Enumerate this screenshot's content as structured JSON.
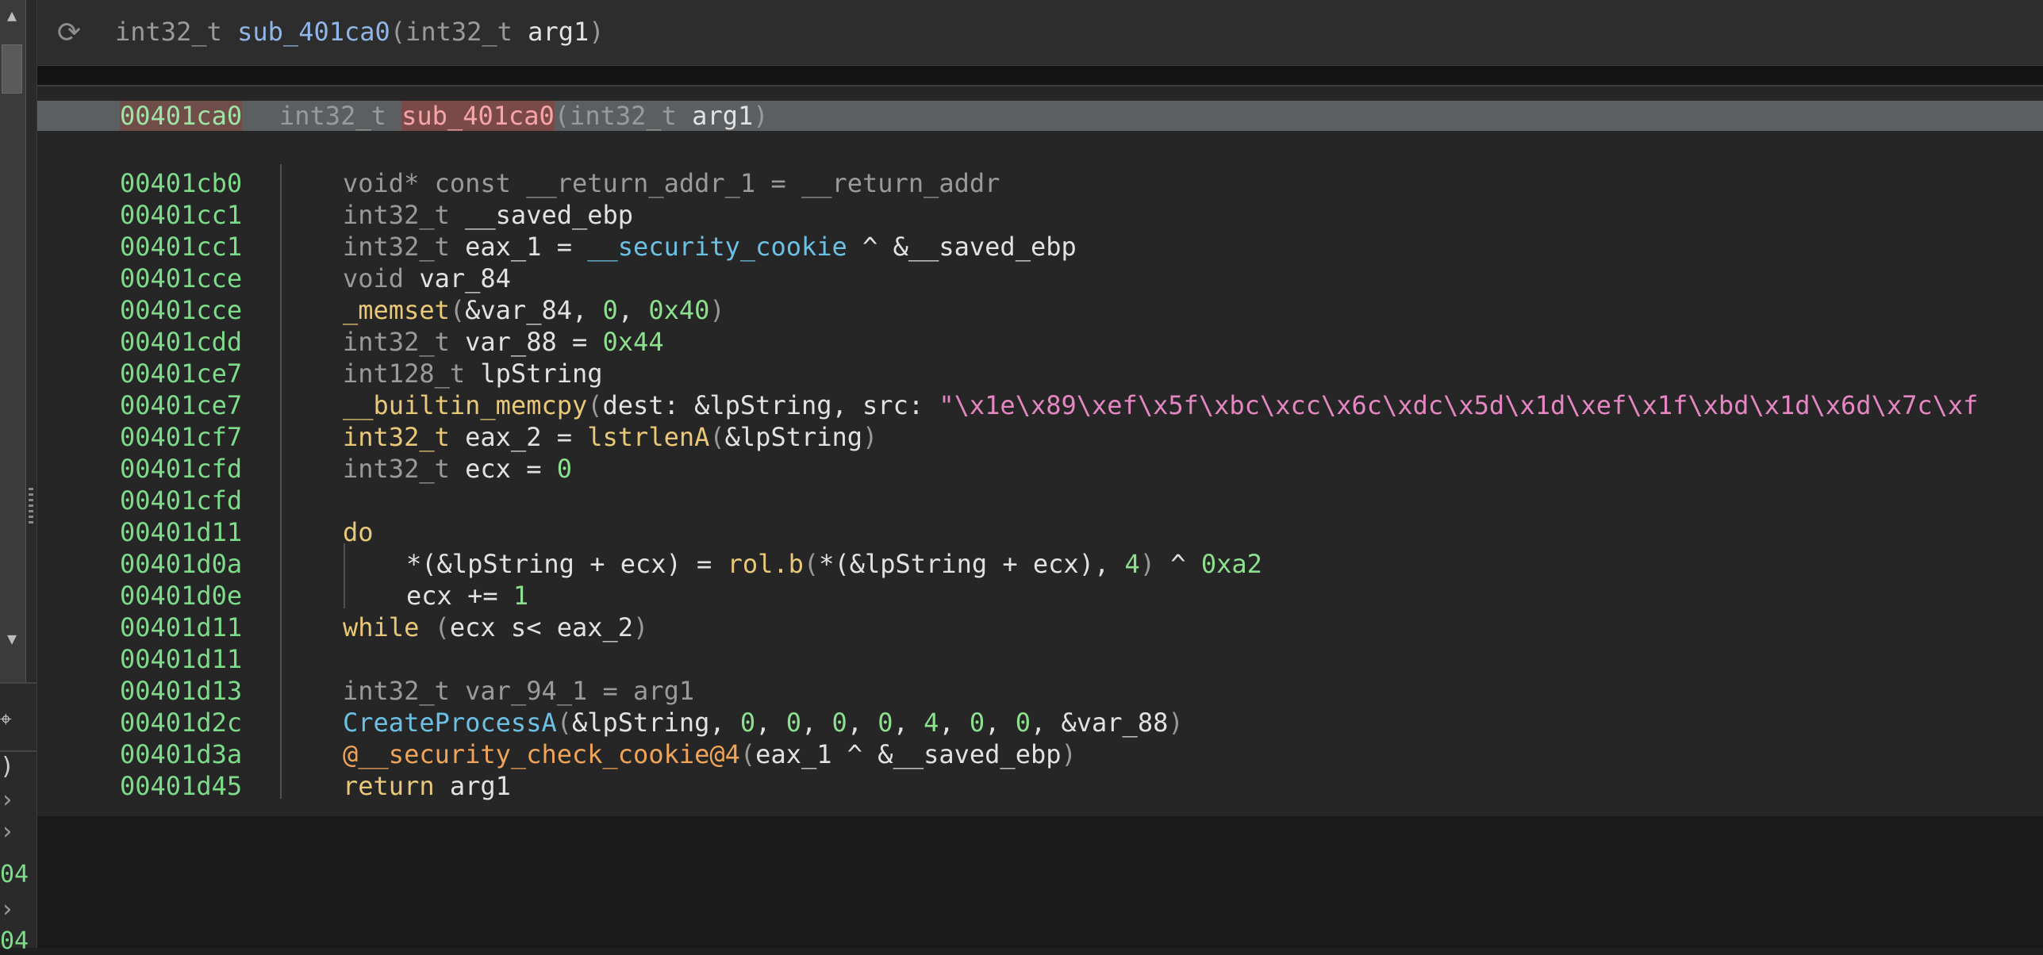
{
  "header": {
    "signature": {
      "ret": "int32_t ",
      "name": "sub_401ca0",
      "open": "(",
      "ptype": "int32_t ",
      "param": "arg1",
      "close": ")"
    }
  },
  "func_row": {
    "address": "00401ca0",
    "signature": {
      "ret": "int32_t ",
      "name": "sub_401ca0",
      "open": "(",
      "ptype": "int32_t ",
      "param": "arg1",
      "close": ")"
    }
  },
  "lines": [
    {
      "addr": "00401cb0",
      "indent": 0,
      "tokens": [
        [
          "void* const __return_addr_1 = __return_addr",
          "type"
        ]
      ]
    },
    {
      "addr": "00401cc1",
      "indent": 0,
      "tokens": [
        [
          "int32_t ",
          "type"
        ],
        [
          "__saved_ebp",
          "var"
        ]
      ]
    },
    {
      "addr": "00401cc1",
      "indent": 0,
      "tokens": [
        [
          "int32_t ",
          "type"
        ],
        [
          "eax_1 = ",
          "var"
        ],
        [
          "__security_cookie",
          "data"
        ],
        [
          " ^ &__saved_ebp",
          "var"
        ]
      ]
    },
    {
      "addr": "00401cce",
      "indent": 0,
      "tokens": [
        [
          "void ",
          "type"
        ],
        [
          "var_84",
          "var"
        ]
      ]
    },
    {
      "addr": "00401cce",
      "indent": 0,
      "tokens": [
        [
          "_memset",
          "fn"
        ],
        [
          "(",
          "p"
        ],
        [
          "&var_84, ",
          "var"
        ],
        [
          "0",
          "num"
        ],
        [
          ", ",
          "var"
        ],
        [
          "0x40",
          "num"
        ],
        [
          ")",
          "p"
        ]
      ]
    },
    {
      "addr": "00401cdd",
      "indent": 0,
      "tokens": [
        [
          "int32_t ",
          "type"
        ],
        [
          "var_88 = ",
          "var"
        ],
        [
          "0x44",
          "num"
        ]
      ]
    },
    {
      "addr": "00401ce7",
      "indent": 0,
      "tokens": [
        [
          "int128_t ",
          "type"
        ],
        [
          "lpString",
          "var"
        ]
      ]
    },
    {
      "addr": "00401ce7",
      "indent": 0,
      "tokens": [
        [
          "__builtin_memcpy",
          "fn"
        ],
        [
          "(",
          "p"
        ],
        [
          "dest: &lpString, src: ",
          "var"
        ],
        [
          "\"\\x1e\\x89\\xef\\x5f\\xbc\\xcc\\x6c\\xdc\\x5d\\x1d\\xef\\x1f\\xbd\\x1d\\x6d\\x7c\\xf",
          "str"
        ]
      ]
    },
    {
      "addr": "00401cf7",
      "indent": 0,
      "tokens": [
        [
          "int32_t ",
          "kw"
        ],
        [
          "eax_2 = ",
          "var"
        ],
        [
          "lstrlenA",
          "fn"
        ],
        [
          "(",
          "p"
        ],
        [
          "&lpString",
          "var"
        ],
        [
          ")",
          "p"
        ]
      ]
    },
    {
      "addr": "00401cfd",
      "indent": 0,
      "tokens": [
        [
          "int32_t ",
          "type"
        ],
        [
          "ecx = ",
          "var"
        ],
        [
          "0",
          "num"
        ]
      ]
    },
    {
      "addr": "00401cfd",
      "indent": 0,
      "tokens": []
    },
    {
      "addr": "00401d11",
      "indent": 0,
      "tokens": [
        [
          "do",
          "kw"
        ]
      ]
    },
    {
      "addr": "00401d0a",
      "indent": 1,
      "tokens": [
        [
          "*(&lpString + ecx) = ",
          "var"
        ],
        [
          "rol.b",
          "fn"
        ],
        [
          "(",
          "p"
        ],
        [
          "*(&lpString + ecx)",
          "var"
        ],
        [
          ", ",
          "var"
        ],
        [
          "4",
          "num"
        ],
        [
          ")",
          "p"
        ],
        [
          " ^ ",
          "var"
        ],
        [
          "0xa2",
          "num"
        ]
      ]
    },
    {
      "addr": "00401d0e",
      "indent": 1,
      "tokens": [
        [
          "ecx += ",
          "var"
        ],
        [
          "1",
          "num"
        ]
      ]
    },
    {
      "addr": "00401d11",
      "indent": 0,
      "tokens": [
        [
          "while ",
          "kw"
        ],
        [
          "(",
          "p"
        ],
        [
          "ecx s< eax_2",
          "var"
        ],
        [
          ")",
          "p"
        ]
      ]
    },
    {
      "addr": "00401d11",
      "indent": 0,
      "tokens": []
    },
    {
      "addr": "00401d13",
      "indent": 0,
      "tokens": [
        [
          "int32_t var_94_1 = arg1",
          "type"
        ]
      ]
    },
    {
      "addr": "00401d2c",
      "indent": 0,
      "tokens": [
        [
          "CreateProcessA",
          "import"
        ],
        [
          "(",
          "p"
        ],
        [
          "&lpString, ",
          "var"
        ],
        [
          "0",
          "num"
        ],
        [
          ", ",
          "var"
        ],
        [
          "0",
          "num"
        ],
        [
          ", ",
          "var"
        ],
        [
          "0",
          "num"
        ],
        [
          ", ",
          "var"
        ],
        [
          "0",
          "num"
        ],
        [
          ", ",
          "var"
        ],
        [
          "4",
          "num"
        ],
        [
          ", ",
          "var"
        ],
        [
          "0",
          "num"
        ],
        [
          ", ",
          "var"
        ],
        [
          "0",
          "num"
        ],
        [
          ", &var_88",
          "var"
        ],
        [
          ")",
          "p"
        ]
      ]
    },
    {
      "addr": "00401d3a",
      "indent": 0,
      "tokens": [
        [
          "@__security_check_cookie@4",
          "cookie"
        ],
        [
          "(",
          "p"
        ],
        [
          "eax_1 ^ &__saved_ebp",
          "var"
        ],
        [
          ")",
          "p"
        ]
      ]
    },
    {
      "addr": "00401d45",
      "indent": 0,
      "tokens": [
        [
          "return ",
          "kw"
        ],
        [
          "arg1",
          "var"
        ]
      ]
    }
  ],
  "left_strip": {
    "fragments": [
      {
        "text": ")",
        "color": "#cfcfcf"
      },
      {
        "text": "›",
        "color": "#9a9a9a"
      },
      {
        "text": "›",
        "color": "#9a9a9a"
      },
      {
        "text": "04",
        "color": "#7ddc8a"
      },
      {
        "text": "›",
        "color": "#9a9a9a"
      },
      {
        "text": "04",
        "color": "#7ddc8a"
      }
    ]
  },
  "icons": {
    "refresh": "refresh-icon",
    "pin": "pin-icon",
    "scroll_up": "scroll-up-arrow",
    "scroll_down": "scroll-down-arrow"
  }
}
